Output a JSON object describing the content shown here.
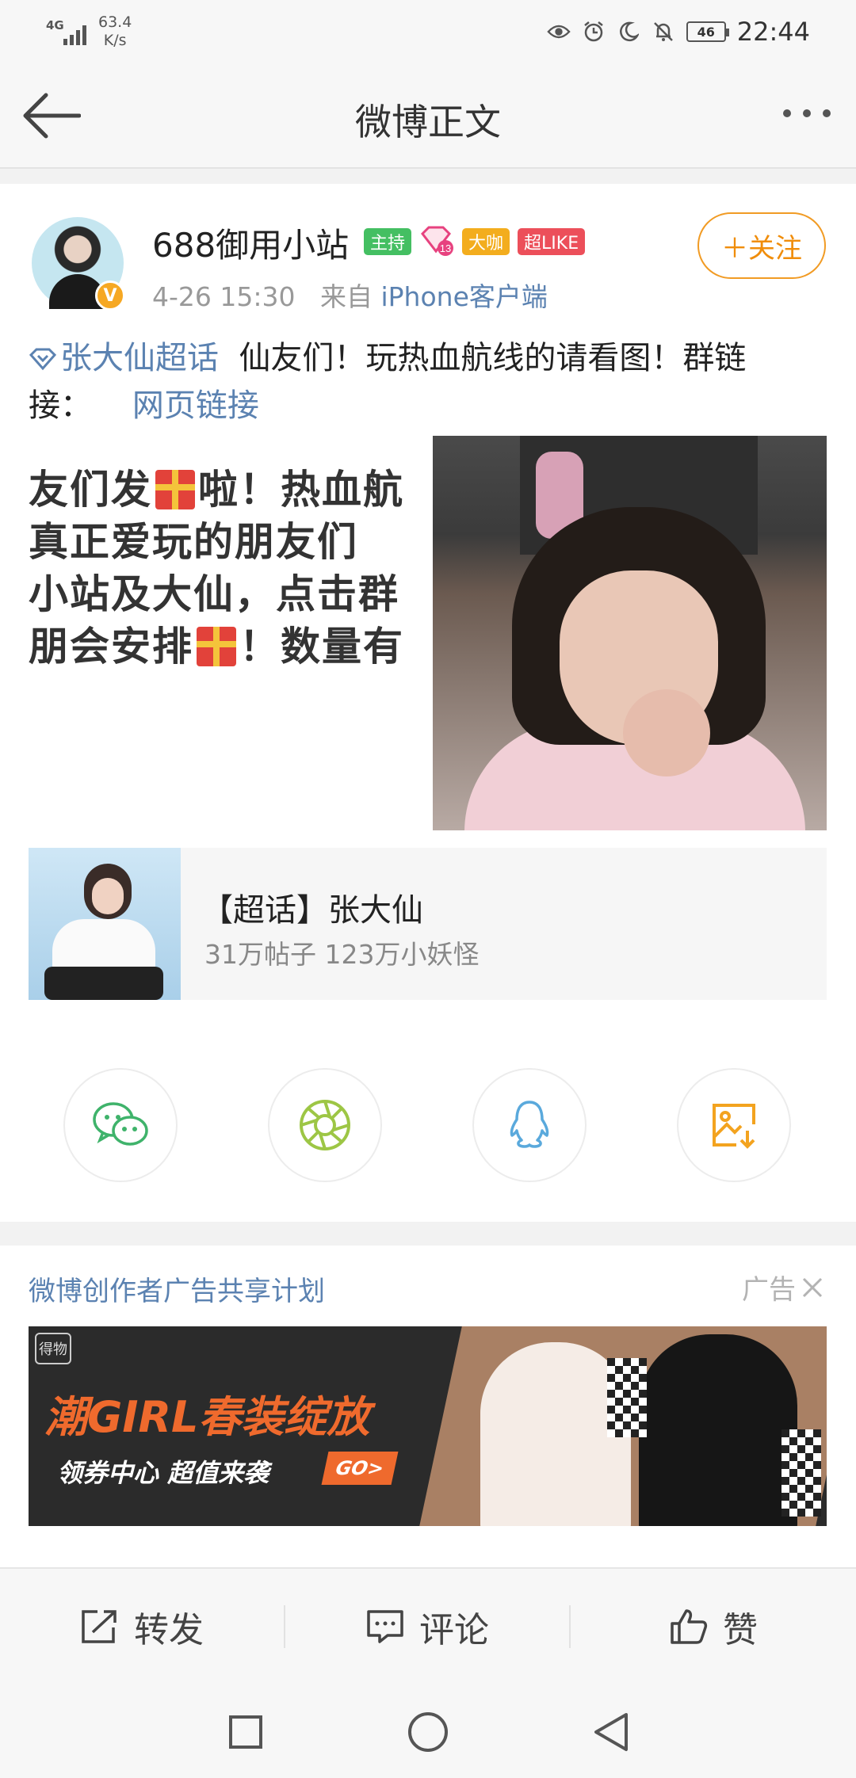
{
  "status_bar": {
    "network": "4G",
    "speed_value": "63.4",
    "speed_unit": "K/s",
    "battery": "46",
    "time": "22:44"
  },
  "nav": {
    "title": "微博正文"
  },
  "post": {
    "user_name": "688御用小站",
    "badges": {
      "host": "主持",
      "level": "13",
      "big": "大咖",
      "like": "超LIKE"
    },
    "verified_mark": "V",
    "time": "4-26 15:30",
    "source_prefix": "来自",
    "source": "iPhone客户端",
    "follow_label": "＋关注",
    "topic_link": "张大仙超话",
    "body_text": "仙友们！玩热血航线的请看图！群链接：",
    "web_link": "网页链接",
    "image_text_lines": [
      "友们发",
      "啦！热血航",
      " 真正爱玩的朋友们",
      "小站及大仙，点击群",
      "朋会安排",
      "！数量有"
    ]
  },
  "topic_card": {
    "title": "【超话】张大仙",
    "stats": "31万帖子 123万小妖怪"
  },
  "share": {
    "items": [
      "wechat-icon",
      "moments-icon",
      "qq-icon",
      "save-image-icon"
    ]
  },
  "ad": {
    "title": "微博创作者广告共享计划",
    "label": "广告",
    "logo_text": "得物",
    "headline": "潮GIRL春装绽放",
    "subline": "领券中心 超值来袭",
    "cta": "GO>"
  },
  "actions": {
    "repost": "转发",
    "comment": "评论",
    "like": "赞"
  },
  "colors": {
    "link": "#5b82b1",
    "follow": "#f08d0b",
    "host_badge": "#44bf62",
    "big_badge": "#f3ad1e",
    "like_badge": "#ec4f5a",
    "wechat": "#3fb36b",
    "moments": "#9dc645",
    "qq": "#5aa9dc",
    "save": "#f3a31f"
  }
}
